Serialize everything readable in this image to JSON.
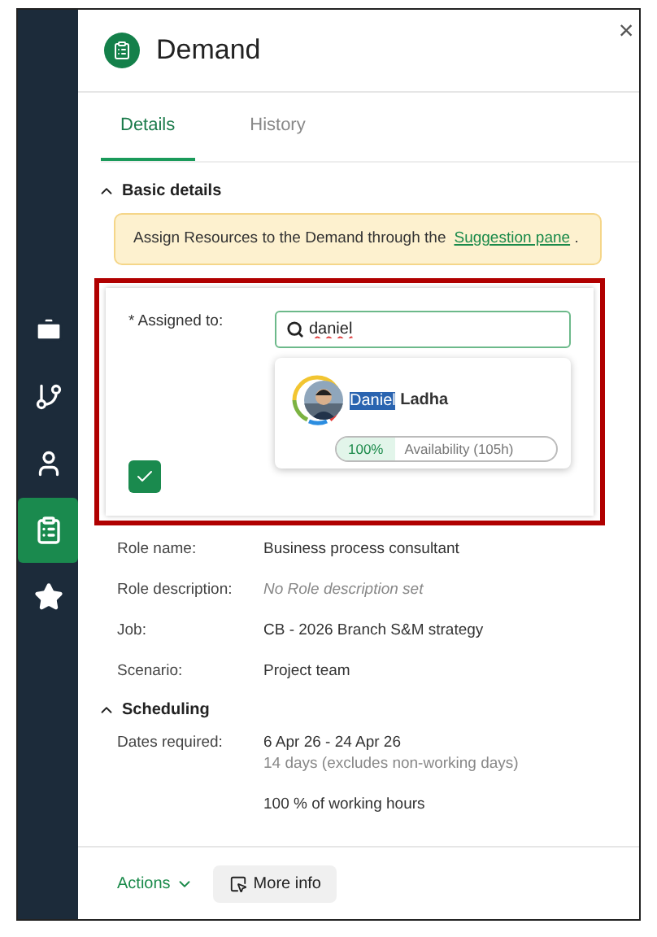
{
  "window": {
    "title": "Demand",
    "close": "×"
  },
  "sidebar": {
    "items": [
      {
        "kind": "briefcase",
        "selected": false
      },
      {
        "kind": "branch",
        "selected": false
      },
      {
        "kind": "person",
        "selected": false
      },
      {
        "kind": "clipboard",
        "selected": true
      },
      {
        "kind": "star",
        "selected": false
      }
    ]
  },
  "tabs": [
    {
      "label": "Details",
      "selected": true
    },
    {
      "label": "History",
      "selected": false
    }
  ],
  "basic_details": {
    "title": "Basic details",
    "expanded": true,
    "notice": {
      "text": "Assign Resources to the Demand through the",
      "link": "Suggestion pane",
      "after": "."
    },
    "assign": {
      "label": "* Assigned to:",
      "search": {
        "value": "daniel"
      },
      "results": [
        {
          "match": "Daniel",
          "rest": " Ladha",
          "percent": "100%",
          "availability": "Availability (105h)"
        }
      ]
    },
    "fields": [
      {
        "label": "Role name:",
        "value": "Business process consultant",
        "kind": "text"
      },
      {
        "label": "Role description:",
        "value": "No Role description set",
        "kind": "placeholder"
      },
      {
        "label": "Job:",
        "value": "CB - 2026 Branch S&M strategy",
        "kind": "text"
      },
      {
        "label": "Scenario:",
        "value": "Project team",
        "kind": "text"
      }
    ]
  },
  "scheduling": {
    "title": "Scheduling",
    "expanded": true,
    "fields": [
      {
        "label": "Dates required:",
        "value": "6 Apr 26 - 24 Apr 26",
        "note": "14 days (excludes non-working days)"
      },
      {
        "value": "100 % of working hours"
      }
    ]
  },
  "footer": {
    "actions": "Actions",
    "more_info": "More info"
  }
}
